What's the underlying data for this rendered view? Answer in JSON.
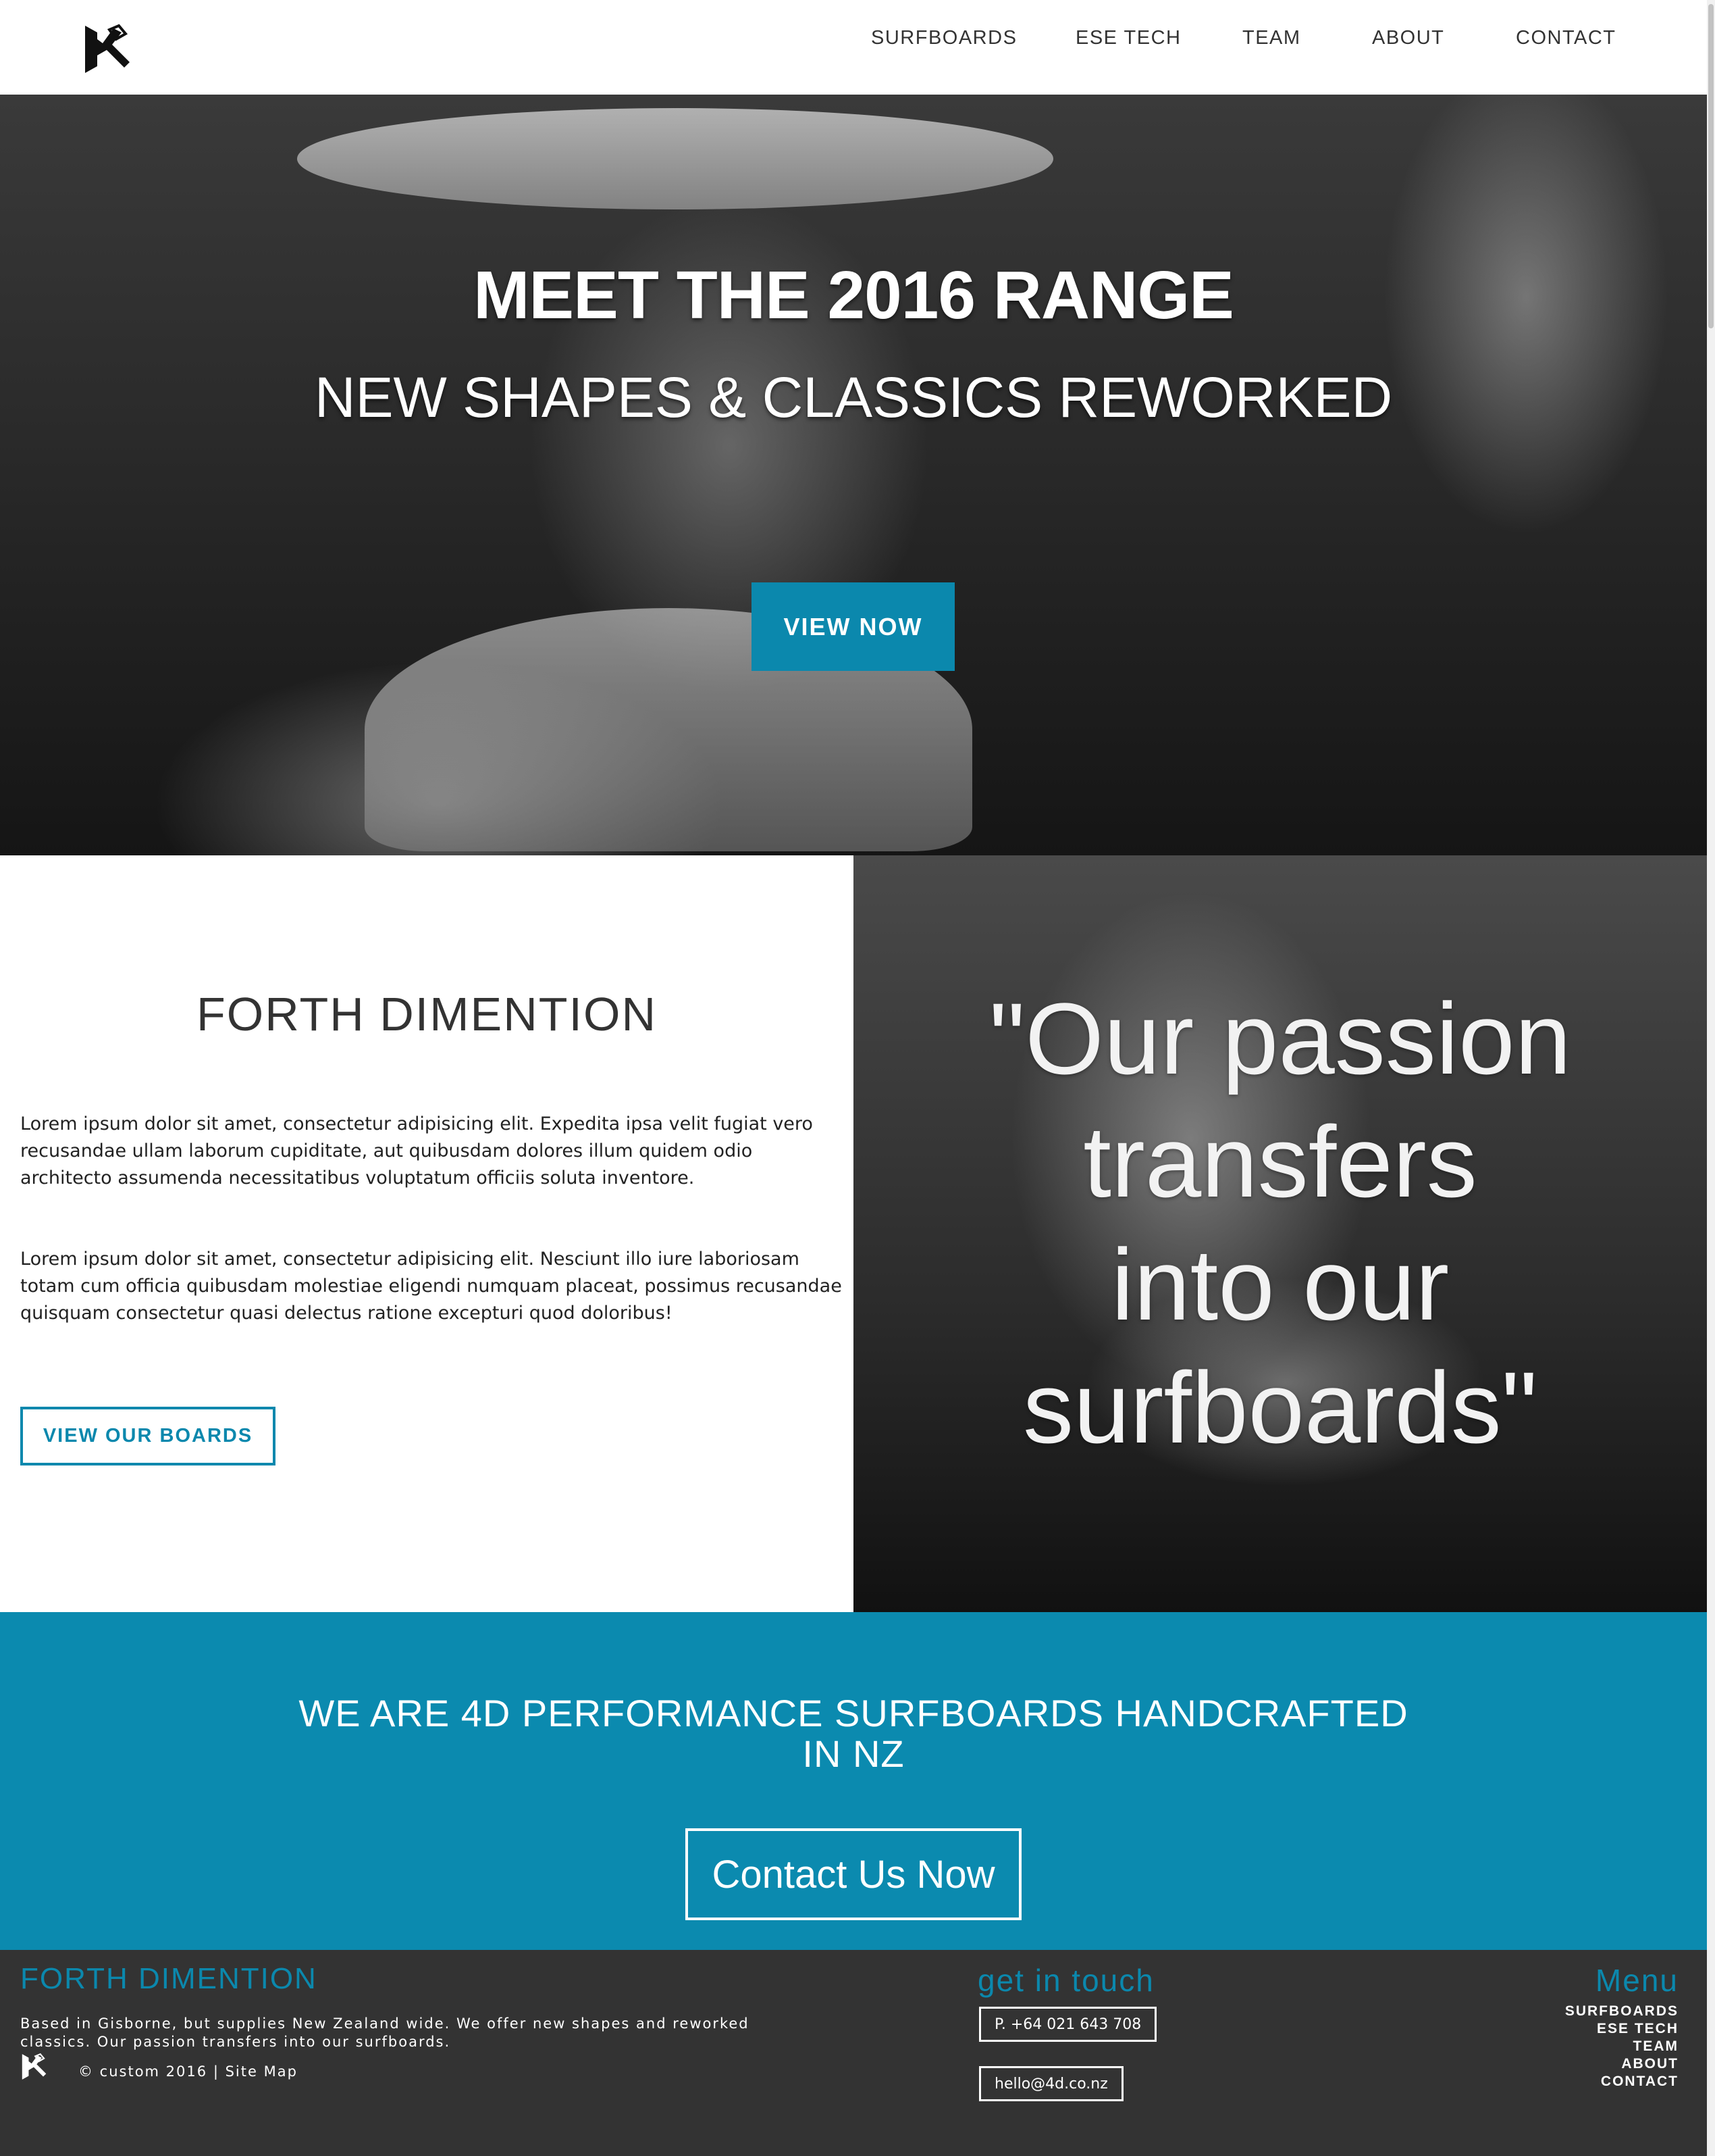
{
  "header": {
    "logo_icon": "4d-logo-icon",
    "nav": [
      "SURFBOARDS",
      "ESE TECH",
      "TEAM",
      "ABOUT",
      "CONTACT"
    ]
  },
  "hero": {
    "title": "MEET THE 2016 RANGE",
    "subtitle": "NEW SHAPES & CLASSICS REWORKED",
    "button": "VIEW NOW"
  },
  "about": {
    "title": "FORTH DIMENTION",
    "paragraph1": "Lorem ipsum dolor sit amet, consectetur adipisicing elit. Expedita ipsa velit fugiat vero recusandae ullam laborum cupiditate, aut quibusdam dolores illum quidem odio architecto assumenda necessitatibus voluptatum officiis soluta inventore.",
    "paragraph2": "Lorem ipsum dolor sit amet, consectetur adipisicing elit. Nesciunt illo iure laboriosam totam cum officia quibusdam molestiae eligendi numquam placeat, possimus recusandae quisquam consectetur quasi delectus ratione excepturi quod doloribus!",
    "button": "VIEW OUR BOARDS",
    "quote_lines": [
      "\"Our passion",
      "transfers",
      "into our",
      "surfboards\""
    ]
  },
  "cta": {
    "title_line1": "WE ARE 4D PERFORMANCE SURFBOARDS HANDCRAFTED",
    "title_line2": "IN NZ",
    "button": "Contact Us Now"
  },
  "footer": {
    "brand": "FORTH DIMENTION",
    "description": "Based in Gisborne, but supplies New Zealand wide. We offer new shapes and reworked classics. Our passion transfers into our surfboards.",
    "copyright": "© custom 2016",
    "separator": "|",
    "sitemap": "Site Map",
    "touch_title": "get in touch",
    "phone": "P. +64 021 643 708",
    "email": "hello@4d.co.nz",
    "menu_title": "Menu",
    "menu": [
      "SURFBOARDS",
      "ESE TECH",
      "TEAM",
      "ABOUT",
      "CONTACT"
    ]
  },
  "colors": {
    "accent": "#0b88ad",
    "footer_bg": "#333333",
    "header_bg": "#ffffff"
  }
}
